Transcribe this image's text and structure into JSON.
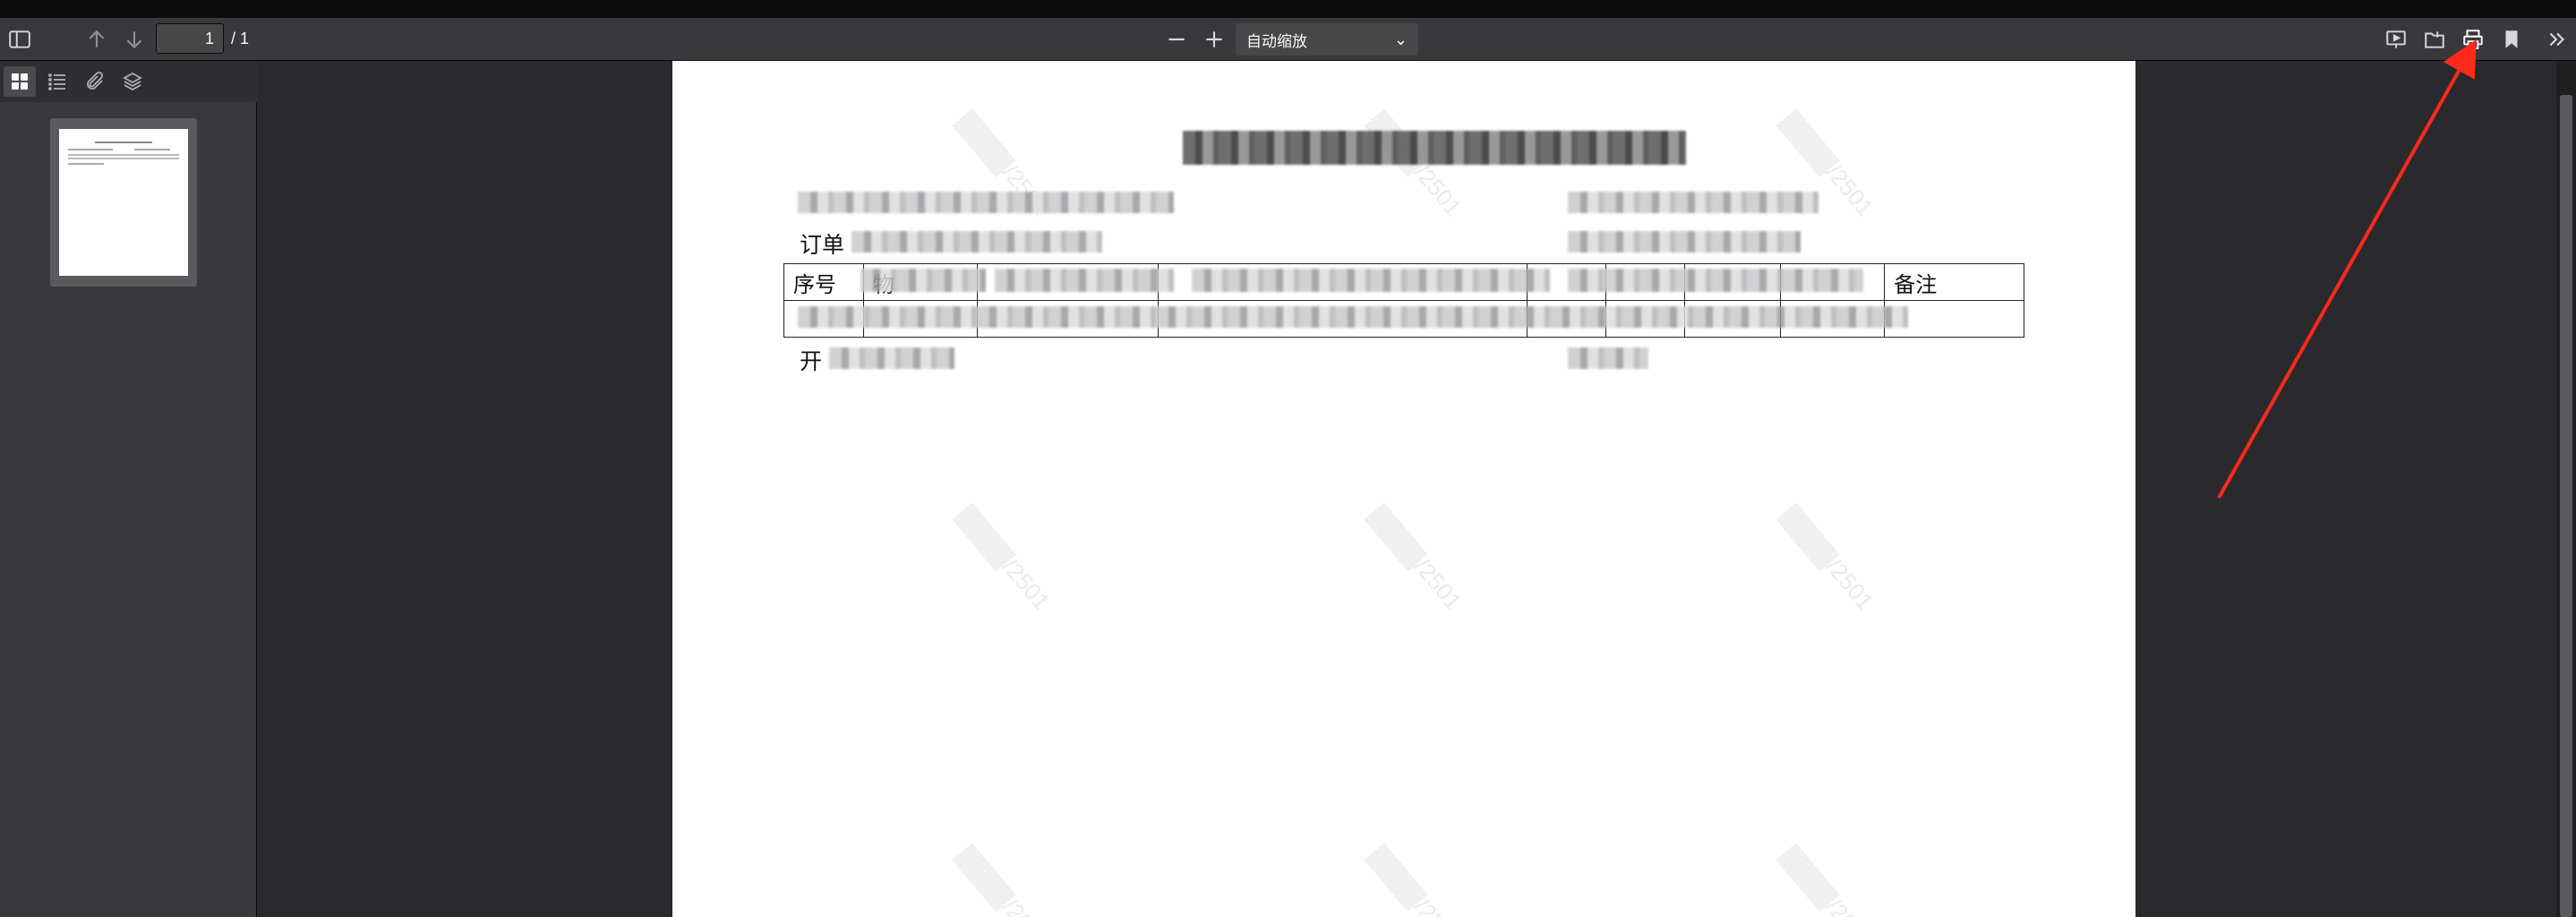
{
  "toolbar": {
    "page_number": "1",
    "page_total": "/ 1",
    "zoom_selected": "自动缩放",
    "icons": [
      "sidebar-toggle-icon",
      "previous-page-icon",
      "next-page-icon",
      "zoom-out-icon",
      "zoom-in-icon",
      "presentation-mode-icon",
      "open-file-icon",
      "print-icon",
      "bookmark-icon",
      "tools-icon"
    ]
  },
  "sidebar": {
    "tabs": [
      "thumbnails-icon",
      "outline-icon",
      "attachments-icon",
      "layers-icon"
    ],
    "active_tab": "thumbnails-icon"
  },
  "document": {
    "order_label": "订单",
    "table_headers": {
      "seq": "序号",
      "col2_prefix": "物",
      "remark": "备注"
    },
    "footer_label": "开"
  },
  "annotation": {
    "arrow_color": "#ff2a1a",
    "target": "print-icon"
  },
  "colors": {
    "toolbar_bg": "#38383d",
    "viewer_bg": "#2a2a2e",
    "page_bg": "#ffffff"
  }
}
